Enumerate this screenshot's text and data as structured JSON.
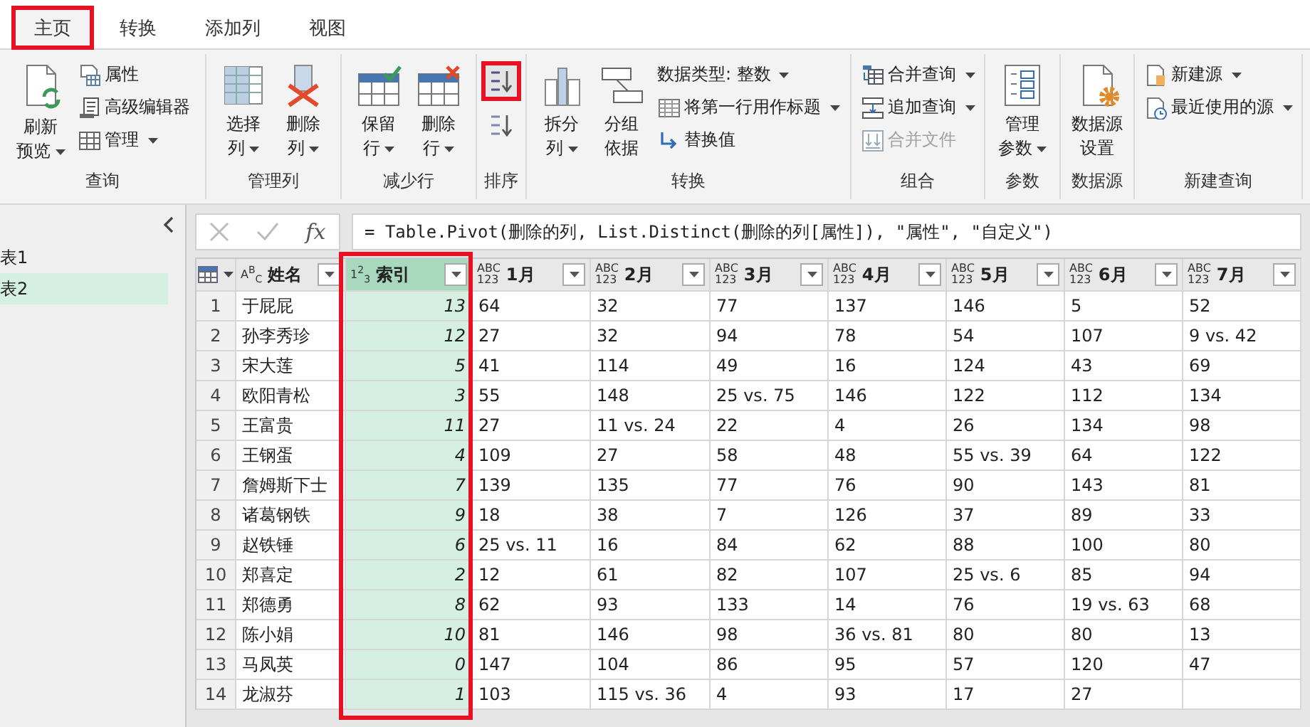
{
  "tabs": [
    {
      "label": "主页",
      "selected": true,
      "highlighted": true
    },
    {
      "label": "转换",
      "selected": false,
      "highlighted": false
    },
    {
      "label": "添加列",
      "selected": false,
      "highlighted": false
    },
    {
      "label": "视图",
      "selected": false,
      "highlighted": false
    }
  ],
  "ribbon": {
    "groups": [
      {
        "label": "查询",
        "items": [
          {
            "kind": "large",
            "lines": [
              "刷新",
              "预览"
            ],
            "dropdown": true
          },
          {
            "kind": "small",
            "label": "属性",
            "dropdown": false,
            "disabled": false
          },
          {
            "kind": "small",
            "label": "高级编辑器",
            "dropdown": false,
            "disabled": false
          },
          {
            "kind": "small",
            "label": "管理",
            "dropdown": true,
            "disabled": false
          }
        ]
      },
      {
        "label": "管理列",
        "items": [
          {
            "kind": "large",
            "lines": [
              "选择",
              "列"
            ],
            "dropdown": true
          },
          {
            "kind": "large",
            "lines": [
              "删除",
              "列"
            ],
            "dropdown": true
          }
        ]
      },
      {
        "label": "减少行",
        "items": [
          {
            "kind": "large",
            "lines": [
              "保留",
              "行"
            ],
            "dropdown": true
          },
          {
            "kind": "large",
            "lines": [
              "删除",
              "行"
            ],
            "dropdown": true
          }
        ]
      },
      {
        "label": "排序",
        "items": [
          {
            "kind": "icon",
            "highlighted": true
          },
          {
            "kind": "icon",
            "highlighted": false
          }
        ]
      },
      {
        "label": "转换",
        "items": [
          {
            "kind": "large",
            "lines": [
              "拆分",
              "列"
            ],
            "dropdown": true
          },
          {
            "kind": "large",
            "lines": [
              "分组",
              "依据"
            ],
            "dropdown": false
          },
          {
            "kind": "small",
            "label": "数据类型: 整数",
            "dropdown": true,
            "disabled": false
          },
          {
            "kind": "small",
            "label": "将第一行用作标题",
            "dropdown": true,
            "disabled": false
          },
          {
            "kind": "small",
            "label": "替换值",
            "dropdown": false,
            "disabled": false
          }
        ]
      },
      {
        "label": "组合",
        "items": [
          {
            "kind": "small",
            "label": "合并查询",
            "dropdown": true,
            "disabled": false
          },
          {
            "kind": "small",
            "label": "追加查询",
            "dropdown": true,
            "disabled": false
          },
          {
            "kind": "small",
            "label": "合并文件",
            "dropdown": false,
            "disabled": true
          }
        ]
      },
      {
        "label": "参数",
        "items": [
          {
            "kind": "large",
            "lines": [
              "管理",
              "参数"
            ],
            "dropdown": true
          }
        ]
      },
      {
        "label": "数据源",
        "items": [
          {
            "kind": "large",
            "lines": [
              "数据源",
              "设置"
            ],
            "dropdown": false
          }
        ]
      },
      {
        "label": "新建查询",
        "items": [
          {
            "kind": "small",
            "label": "新建源",
            "dropdown": true,
            "disabled": false
          },
          {
            "kind": "small",
            "label": "最近使用的源",
            "dropdown": true,
            "disabled": false
          }
        ]
      }
    ]
  },
  "queries": {
    "items": [
      {
        "label": "表1",
        "selected": false
      },
      {
        "label": "表2",
        "selected": true
      }
    ]
  },
  "formula_bar": {
    "fx_label": "fx",
    "formula": "= Table.Pivot(删除的列, List.Distinct(删除的列[属性]), \"属性\", \"自定义\")"
  },
  "table": {
    "columns": [
      {
        "label": "姓名",
        "kind": "text",
        "type_icon": [
          "A$^{B}$$_{C}$"
        ],
        "selected": false,
        "highlighted": false
      },
      {
        "label": "索引",
        "kind": "number",
        "type_icon": [
          "1$^{2}$$_{3}$"
        ],
        "selected": true,
        "highlighted": true
      },
      {
        "label": "1月",
        "kind": "any",
        "type_icon": [
          "ABC",
          "123"
        ],
        "selected": false,
        "highlighted": false
      },
      {
        "label": "2月",
        "kind": "any",
        "type_icon": [
          "ABC",
          "123"
        ],
        "selected": false,
        "highlighted": false
      },
      {
        "label": "3月",
        "kind": "any",
        "type_icon": [
          "ABC",
          "123"
        ],
        "selected": false,
        "highlighted": false
      },
      {
        "label": "4月",
        "kind": "any",
        "type_icon": [
          "ABC",
          "123"
        ],
        "selected": false,
        "highlighted": false
      },
      {
        "label": "5月",
        "kind": "any",
        "type_icon": [
          "ABC",
          "123"
        ],
        "selected": false,
        "highlighted": false
      },
      {
        "label": "6月",
        "kind": "any",
        "type_icon": [
          "ABC",
          "123"
        ],
        "selected": false,
        "highlighted": false
      },
      {
        "label": "7月",
        "kind": "any",
        "type_icon": [
          "ABC",
          "123"
        ],
        "selected": false,
        "highlighted": false
      }
    ],
    "rows": [
      {
        "index": "1",
        "cells": [
          "于屁屁",
          "13",
          "64",
          "32",
          "77",
          "137",
          "146",
          "5",
          "52"
        ]
      },
      {
        "index": "2",
        "cells": [
          "孙李秀珍",
          "12",
          "27",
          "32",
          "94",
          "78",
          "54",
          "107",
          "9 vs. 42"
        ]
      },
      {
        "index": "3",
        "cells": [
          "宋大莲",
          "5",
          "41",
          "114",
          "49",
          "16",
          "124",
          "43",
          "69"
        ]
      },
      {
        "index": "4",
        "cells": [
          "欧阳青松",
          "3",
          "55",
          "148",
          "25 vs. 75",
          "146",
          "122",
          "112",
          "134"
        ]
      },
      {
        "index": "5",
        "cells": [
          "王富贵",
          "11",
          "27",
          "11 vs. 24",
          "22",
          "4",
          "26",
          "134",
          "98"
        ]
      },
      {
        "index": "6",
        "cells": [
          "王钢蛋",
          "4",
          "109",
          "27",
          "58",
          "48",
          "55 vs. 39",
          "64",
          "122"
        ]
      },
      {
        "index": "7",
        "cells": [
          "詹姆斯下士",
          "7",
          "139",
          "135",
          "77",
          "76",
          "90",
          "143",
          "81"
        ]
      },
      {
        "index": "8",
        "cells": [
          "诸葛钢铁",
          "9",
          "18",
          "38",
          "7",
          "126",
          "37",
          "89",
          "33"
        ]
      },
      {
        "index": "9",
        "cells": [
          "赵铁锤",
          "6",
          "25 vs. 11",
          "16",
          "84",
          "62",
          "88",
          "100",
          "80"
        ]
      },
      {
        "index": "10",
        "cells": [
          "郑喜定",
          "2",
          "12",
          "61",
          "82",
          "107",
          "25 vs. 6",
          "85",
          "94"
        ]
      },
      {
        "index": "11",
        "cells": [
          "郑德勇",
          "8",
          "62",
          "93",
          "133",
          "14",
          "76",
          "19 vs. 63",
          "68"
        ]
      },
      {
        "index": "12",
        "cells": [
          "陈小娟",
          "10",
          "81",
          "146",
          "98",
          "36 vs. 81",
          "80",
          "80",
          "13"
        ]
      },
      {
        "index": "13",
        "cells": [
          "马凤英",
          "0",
          "147",
          "104",
          "86",
          "95",
          "57",
          "120",
          "47"
        ]
      },
      {
        "index": "14",
        "cells": [
          "龙淑芬",
          "1",
          "103",
          "115 vs. 36",
          "4",
          "93",
          "17",
          "27"
        ]
      }
    ]
  }
}
